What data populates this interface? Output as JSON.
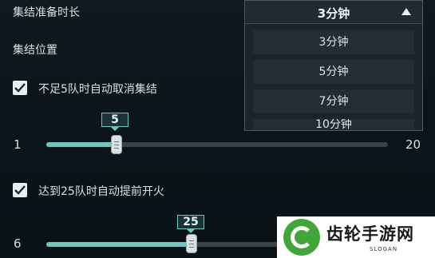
{
  "settings": {
    "assembly_time_label": "集结准备时长",
    "assembly_position_label": "集结位置",
    "cancel_option": {
      "label": "不足5队时自动取消集结",
      "checked": true,
      "slider": {
        "min": "1",
        "max": "20",
        "value": "5"
      }
    },
    "fire_option": {
      "label": "达到25队时自动提前开火",
      "checked": true,
      "slider": {
        "min": "6",
        "value": "25"
      }
    }
  },
  "dropdown": {
    "selected": "3分钟",
    "options": [
      "3分钟",
      "5分钟",
      "7分钟",
      "10分钟"
    ]
  },
  "watermark": {
    "name": "齿轮手游网",
    "slogan": "SLOGAN"
  },
  "colors": {
    "accent": "#6fc6bf",
    "checkbox": "#e8eef0",
    "logo_green": "#3fa637"
  }
}
